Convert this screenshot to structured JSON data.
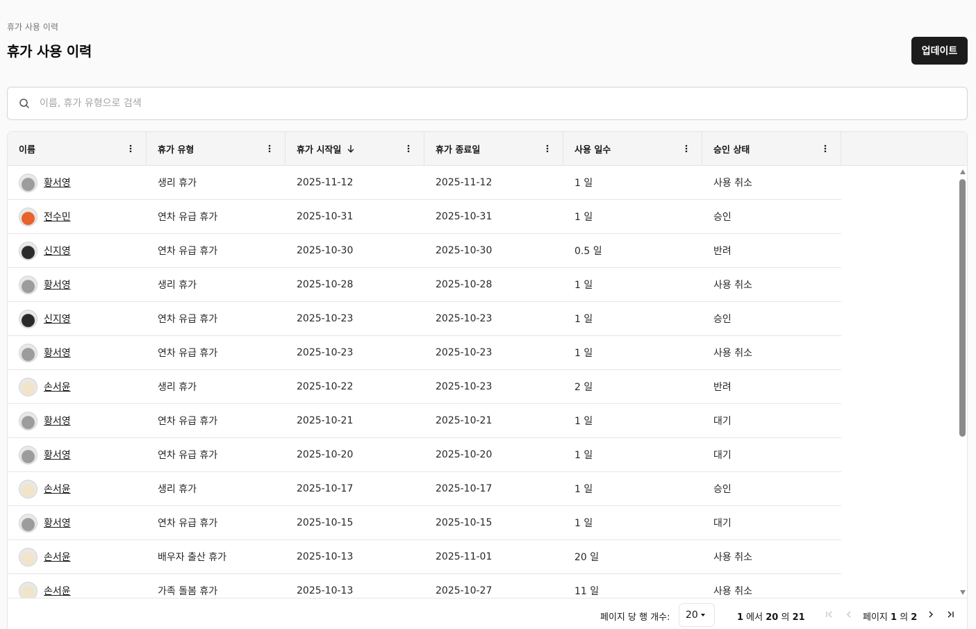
{
  "breadcrumb": "휴가 사용 이력",
  "title": "휴가 사용 이력",
  "update_button": "업데이트",
  "search": {
    "placeholder": "이름, 휴가 유형으로 검색",
    "value": ""
  },
  "columns": [
    {
      "label": "이름",
      "sorted": false
    },
    {
      "label": "휴가 유형",
      "sorted": false
    },
    {
      "label": "휴가 시작일",
      "sorted": "desc"
    },
    {
      "label": "휴가 종료일",
      "sorted": false
    },
    {
      "label": "사용 일수",
      "sorted": false
    },
    {
      "label": "승인 상태",
      "sorted": false
    }
  ],
  "rows": [
    {
      "name": "황서영",
      "avatar": "gray-cat-icon",
      "type": "생리 휴가",
      "start": "2025-11-12",
      "end": "2025-11-12",
      "days": "1 일",
      "status": "사용 취소"
    },
    {
      "name": "전수민",
      "avatar": "orange-fox-icon",
      "type": "연차 유급 휴가",
      "start": "2025-10-31",
      "end": "2025-10-31",
      "days": "1 일",
      "status": "승인"
    },
    {
      "name": "신지영",
      "avatar": "black-cat-icon",
      "type": "연차 유급 휴가",
      "start": "2025-10-30",
      "end": "2025-10-30",
      "days": "0.5 일",
      "status": "반려"
    },
    {
      "name": "황서영",
      "avatar": "gray-cat-icon",
      "type": "생리 휴가",
      "start": "2025-10-28",
      "end": "2025-10-28",
      "days": "1 일",
      "status": "사용 취소"
    },
    {
      "name": "신지영",
      "avatar": "black-cat-icon",
      "type": "연차 유급 휴가",
      "start": "2025-10-23",
      "end": "2025-10-23",
      "days": "1 일",
      "status": "승인"
    },
    {
      "name": "황서영",
      "avatar": "gray-cat-icon",
      "type": "연차 유급 휴가",
      "start": "2025-10-23",
      "end": "2025-10-23",
      "days": "1 일",
      "status": "사용 취소"
    },
    {
      "name": "손서윤",
      "avatar": "white-cat-icon",
      "type": "생리 휴가",
      "start": "2025-10-22",
      "end": "2025-10-23",
      "days": "2 일",
      "status": "반려"
    },
    {
      "name": "황서영",
      "avatar": "gray-cat-icon",
      "type": "연차 유급 휴가",
      "start": "2025-10-21",
      "end": "2025-10-21",
      "days": "1 일",
      "status": "대기"
    },
    {
      "name": "황서영",
      "avatar": "gray-cat-icon",
      "type": "연차 유급 휴가",
      "start": "2025-10-20",
      "end": "2025-10-20",
      "days": "1 일",
      "status": "대기"
    },
    {
      "name": "손서윤",
      "avatar": "white-cat-icon",
      "type": "생리 휴가",
      "start": "2025-10-17",
      "end": "2025-10-17",
      "days": "1 일",
      "status": "승인"
    },
    {
      "name": "황서영",
      "avatar": "gray-cat-icon",
      "type": "연차 유급 휴가",
      "start": "2025-10-15",
      "end": "2025-10-15",
      "days": "1 일",
      "status": "대기"
    },
    {
      "name": "손서윤",
      "avatar": "white-cat-icon",
      "type": "배우자 출산 휴가",
      "start": "2025-10-13",
      "end": "2025-11-01",
      "days": "20 일",
      "status": "사용 취소"
    },
    {
      "name": "손서윤",
      "avatar": "white-cat-icon",
      "type": "가족 돌봄 휴가",
      "start": "2025-10-13",
      "end": "2025-10-27",
      "days": "11 일",
      "status": "사용 취소"
    }
  ],
  "footer": {
    "rows_per_page_label": "페이지 당 행 개수:",
    "rows_per_page": "20",
    "range_start": "1",
    "range_mid1": " 에서 ",
    "range_end": "20",
    "range_mid2": " 의 ",
    "total": "21",
    "page_prefix": "페이지 ",
    "page_current": "1",
    "page_mid": " 의 ",
    "page_total": "2"
  },
  "colors": {
    "accent": "#1c1c1c",
    "avatar_gray": "#9c9c9c",
    "avatar_orange": "#e8622c",
    "avatar_black": "#2a2a2a",
    "avatar_white": "#f1e4c8"
  }
}
